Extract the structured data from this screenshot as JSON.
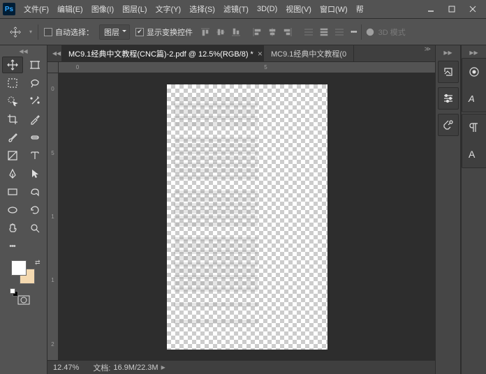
{
  "menus": [
    "文件(F)",
    "编辑(E)",
    "图像(I)",
    "图层(L)",
    "文字(Y)",
    "选择(S)",
    "滤镜(T)",
    "3D(D)",
    "视图(V)",
    "窗口(W)",
    "帮"
  ],
  "options": {
    "auto_select_label": "自动选择：",
    "layer_dropdown": "图层",
    "show_transform_label": "显示变换控件",
    "mode_3d_label": "3D 模式"
  },
  "tabs": [
    {
      "title": "MC9.1经典中文教程(CNC篇)-2.pdf @ 12.5%(RGB/8) *",
      "active": true
    },
    {
      "title": "MC9.1经典中文教程(0",
      "active": false
    }
  ],
  "ruler_h": [
    "0",
    "5"
  ],
  "ruler_v": [
    "0",
    "5",
    "1",
    "1",
    "2"
  ],
  "status": {
    "zoom": "12.47%",
    "doc_label": "文档:",
    "doc_size": "16.9M/22.3M"
  },
  "swatch": {
    "fg": "#ffffff",
    "bg": "#f4d9b0"
  }
}
